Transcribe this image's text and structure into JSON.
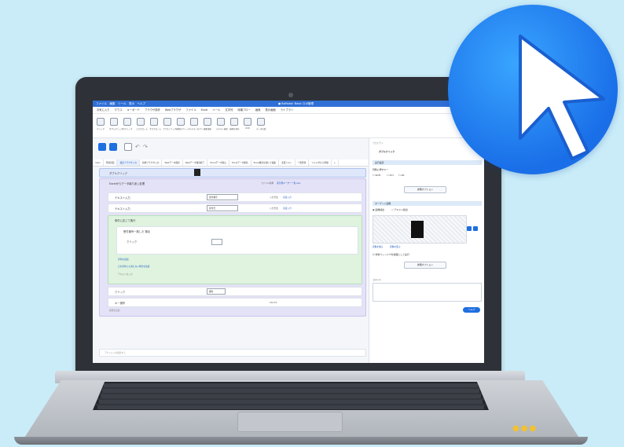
{
  "app": {
    "title_left": "ファイル　編集　ツール　表示　ヘルプ",
    "title_center": "● BizRobo! Basic ロボ管理",
    "menu": [
      "お気に入り",
      "マウス",
      "キーボード",
      "ブラウザ操作",
      "Webブラウザ",
      "ファイル",
      "Excel",
      "メール",
      "文字列",
      "待機フロー",
      "画像",
      "表示画面",
      "ライブラリ"
    ],
    "ribbon": [
      "クリック",
      "ダブルクリック",
      "右クリック",
      "上スクロール",
      "下スクロール",
      "マウスドラッグ",
      "画像をクリック",
      "テキストをクリック",
      "色を検知",
      "テキスト検索",
      "画像を保存",
      "OCR",
      "データ比較"
    ],
    "tabs": [
      "main",
      "登録画面",
      "検証ブラウザ入力",
      "新規ブラウザ入力",
      "Webデータ保存",
      "Webデータ保存終了",
      "Excelデータ取込",
      "Excelデータ保存",
      "Excel保存を開いて編集",
      "変更リスト",
      "一覧登録",
      "フォルダから再開"
    ]
  },
  "flow": {
    "top_action": "ダブルクリック",
    "loop_title": "Excelからデータ繰り返し処理",
    "loop_right": "ファイル名称",
    "loop_link": "東京都ユーザー一覧.xlsx",
    "text1": "テキスト入力",
    "text1_value": "受付番号",
    "text1_right": "入力方法",
    "text1_badge": "直接入力",
    "text2": "テキスト入力",
    "text2_value": "受付日",
    "text2_right": "入力方法",
    "text2_badge": "直接入力",
    "cond_title": "条件に応じて実行",
    "cond_inner": "受付番号一致した 場合",
    "cond_click": "クリック",
    "cond_add": "条件を追加",
    "cond_else": "どの条件にも満たない場合を追加",
    "cond_footnote": "テキストを入力",
    "click": "クリック",
    "click_value": "保存",
    "key": "キー操作",
    "key_right": "Alt+F4",
    "end_note": "処理を追加",
    "search_placeholder": "アクションを検索する"
  },
  "panel": {
    "header": "プロパティ",
    "action": "ダブルクリック",
    "sec1": "実行設定",
    "mod_label": "同時に押すキー",
    "mod_keys": [
      "Shift",
      "Ctrl",
      "Alt"
    ],
    "detail_btn": "詳細オプション",
    "sec2": "ターゲット画像",
    "radio1": "画像検出",
    "radio2": "テキスト検出",
    "link1": "画像を撮る",
    "link2": "画像を選ぶ",
    "checkbox": "対象ウィンドウを前面にして実行",
    "detail_btn2": "詳細オプション",
    "comment": "コメント",
    "help": "ヘルプ"
  },
  "colors": {
    "accent": "#1f6fe0",
    "loop_bg": "#e4e2f7",
    "cond_bg": "#dff3df",
    "badge": "#1a6fe8"
  }
}
